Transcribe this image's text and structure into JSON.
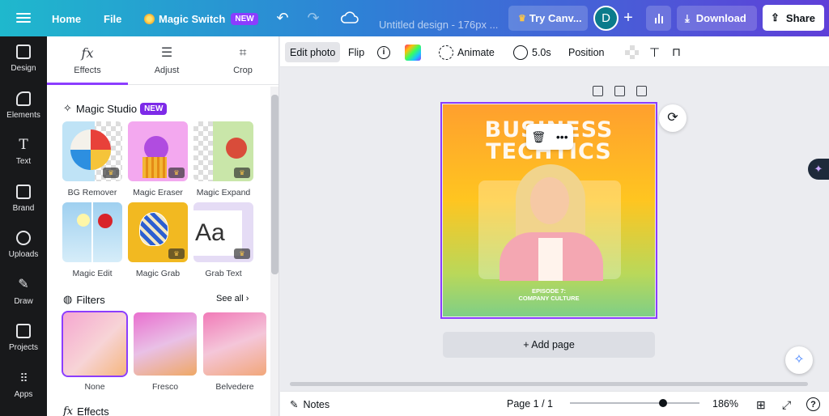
{
  "topbar": {
    "home": "Home",
    "file": "File",
    "magic_switch": "Magic Switch",
    "new_badge": "NEW",
    "title": "Untitled design - 176px ...",
    "try_canva": "Try Canv...",
    "avatar_letter": "D",
    "download": "Download",
    "share": "Share"
  },
  "rail": {
    "items": [
      {
        "label": "Design",
        "icon": "layout-icon"
      },
      {
        "label": "Elements",
        "icon": "shapes-icon"
      },
      {
        "label": "Text",
        "icon": "text-icon"
      },
      {
        "label": "Brand",
        "icon": "brand-icon"
      },
      {
        "label": "Uploads",
        "icon": "upload-icon"
      },
      {
        "label": "Draw",
        "icon": "pen-icon"
      },
      {
        "label": "Projects",
        "icon": "folder-icon"
      },
      {
        "label": "Apps",
        "icon": "apps-icon"
      }
    ]
  },
  "panel": {
    "tabs": [
      {
        "label": "Effects",
        "icon": "fx"
      },
      {
        "label": "Adjust",
        "icon": "sliders"
      },
      {
        "label": "Crop",
        "icon": "crop"
      }
    ],
    "magic_studio": "Magic Studio",
    "magic_badge": "NEW",
    "tools": [
      {
        "label": "BG Remover"
      },
      {
        "label": "Magic Eraser"
      },
      {
        "label": "Magic Expand"
      },
      {
        "label": "Magic Edit"
      },
      {
        "label": "Magic Grab"
      },
      {
        "label": "Grab Text"
      }
    ],
    "filters_title": "Filters",
    "see_all": "See all",
    "filters": [
      {
        "label": "None"
      },
      {
        "label": "Fresco"
      },
      {
        "label": "Belvedere"
      }
    ],
    "effects_title": "Effects"
  },
  "context": {
    "edit_photo": "Edit photo",
    "flip": "Flip",
    "animate": "Animate",
    "duration": "5.0s",
    "position": "Position"
  },
  "design": {
    "headline_1": "BUSINESS",
    "headline_2": "TECHTICS",
    "episode": "EPISODE 7:",
    "subtitle": "COMPANY CULTURE"
  },
  "canvas": {
    "add_page": "+ Add page"
  },
  "bottombar": {
    "notes": "Notes",
    "page": "Page 1 / 1",
    "zoom": "186%",
    "zoom_level": 0.72
  },
  "colors": {
    "accent": "#8b3dff",
    "topbar_start": "#1fb8cd",
    "topbar_end": "#5f3fd8"
  }
}
